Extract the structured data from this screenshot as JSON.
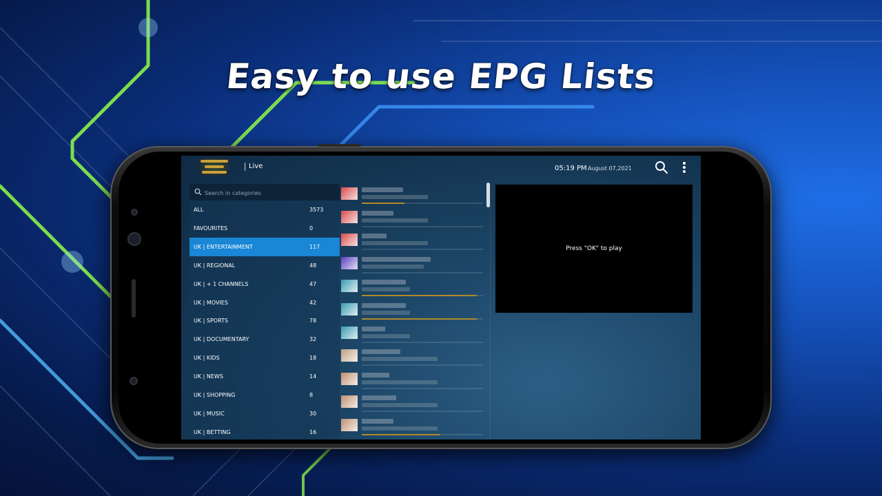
{
  "headline": "Easy to use EPG Lists",
  "app": {
    "section": "Live",
    "time": "05:19 PM",
    "date": "August 07,2021",
    "icons": [
      "search-icon",
      "more-vert-icon"
    ]
  },
  "categories": {
    "search_placeholder": "Search in categories",
    "items": [
      {
        "name": "ALL",
        "count": "3573"
      },
      {
        "name": "FAVOURITES",
        "count": "0"
      },
      {
        "name": "UK | ENTERTAINMENT",
        "count": "117"
      },
      {
        "name": "UK | REGIONAL",
        "count": "48"
      },
      {
        "name": "UK | + 1 CHANNELS",
        "count": "47"
      },
      {
        "name": "UK | MOVIES",
        "count": "42"
      },
      {
        "name": "UK | SPORTS",
        "count": "78"
      },
      {
        "name": "UK | DOCUMENTARY",
        "count": "32"
      },
      {
        "name": "UK | KIDS",
        "count": "18"
      },
      {
        "name": "UK | NEWS",
        "count": "14"
      },
      {
        "name": "UK | SHOPPING",
        "count": "8"
      },
      {
        "name": "UK | MUSIC",
        "count": "30"
      },
      {
        "name": "UK | BETTING",
        "count": "16"
      }
    ],
    "selected": "UK | ENTERTAINMENT"
  },
  "channels": [
    {
      "thumb_color": "#d84a4a",
      "progress": 0.35
    },
    {
      "thumb_color": "#d84a4a",
      "progress": 0.0
    },
    {
      "thumb_color": "#d84a4a",
      "progress": 0.0
    },
    {
      "thumb_color": "#5a3fc0",
      "progress": 0.0
    },
    {
      "thumb_color": "#3a9ab0",
      "progress": 0.95
    },
    {
      "thumb_color": "#3a9ab0",
      "progress": 0.95
    },
    {
      "thumb_color": "#3a9ab0",
      "progress": 0.0
    },
    {
      "thumb_color": "#c0a080",
      "progress": 0.0
    },
    {
      "thumb_color": "#c09070",
      "progress": 0.0
    },
    {
      "thumb_color": "#c09070",
      "progress": 0.0
    },
    {
      "thumb_color": "#c09070",
      "progress": 0.65
    }
  ],
  "player": {
    "message": "Press \"OK\" to play"
  }
}
